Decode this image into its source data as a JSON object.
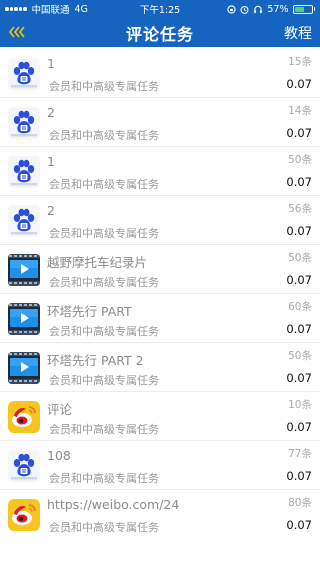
{
  "status_bar": {
    "carrier": "中国联通",
    "network": "4G",
    "time": "下午1:25",
    "battery": "57%",
    "battery_level": 0.57
  },
  "nav": {
    "back_icon": "triple-chevron-left-icon",
    "title": "评论任务",
    "right_label": "教程"
  },
  "colors": {
    "nav_background": "#1565c0",
    "price_text": "#111111",
    "muted_text": "#9a9a9a"
  },
  "tasks": [
    {
      "icon": "baidu-paw-icon",
      "title": "1",
      "subtitle": "会员和中高级专属任务",
      "count": "15条",
      "price": "0.07"
    },
    {
      "icon": "baidu-paw-icon",
      "title": "2",
      "subtitle": "会员和中高级专属任务",
      "count": "14条",
      "price": "0.07"
    },
    {
      "icon": "baidu-paw-icon",
      "title": "1",
      "subtitle": "会员和中高级专属任务",
      "count": "50条",
      "price": "0.07"
    },
    {
      "icon": "baidu-paw-icon",
      "title": "2",
      "subtitle": "会员和中高级专属任务",
      "count": "56条",
      "price": "0.07"
    },
    {
      "icon": "video-player-icon",
      "title": "越野摩托车纪录片",
      "subtitle": "会员和中高级专属任务",
      "count": "50条",
      "price": "0.07"
    },
    {
      "icon": "video-player-icon",
      "title": "环塔先行 PART",
      "subtitle": "会员和中高级专属任务",
      "count": "60条",
      "price": "0.07"
    },
    {
      "icon": "video-player-icon",
      "title": "环塔先行 PART 2",
      "subtitle": "会员和中高级专属任务",
      "count": "50条",
      "price": "0.07"
    },
    {
      "icon": "weibo-icon",
      "title": "评论",
      "subtitle": "会员和中高级专属任务",
      "count": "10条",
      "price": "0.07"
    },
    {
      "icon": "baidu-paw-icon",
      "title": "108",
      "subtitle": "会员和中高级专属任务",
      "count": "77条",
      "price": "0.07"
    },
    {
      "icon": "weibo-icon",
      "title": "https://weibo.com/24",
      "subtitle": "会员和中高级专属任务",
      "count": "80条",
      "price": "0.07"
    }
  ]
}
